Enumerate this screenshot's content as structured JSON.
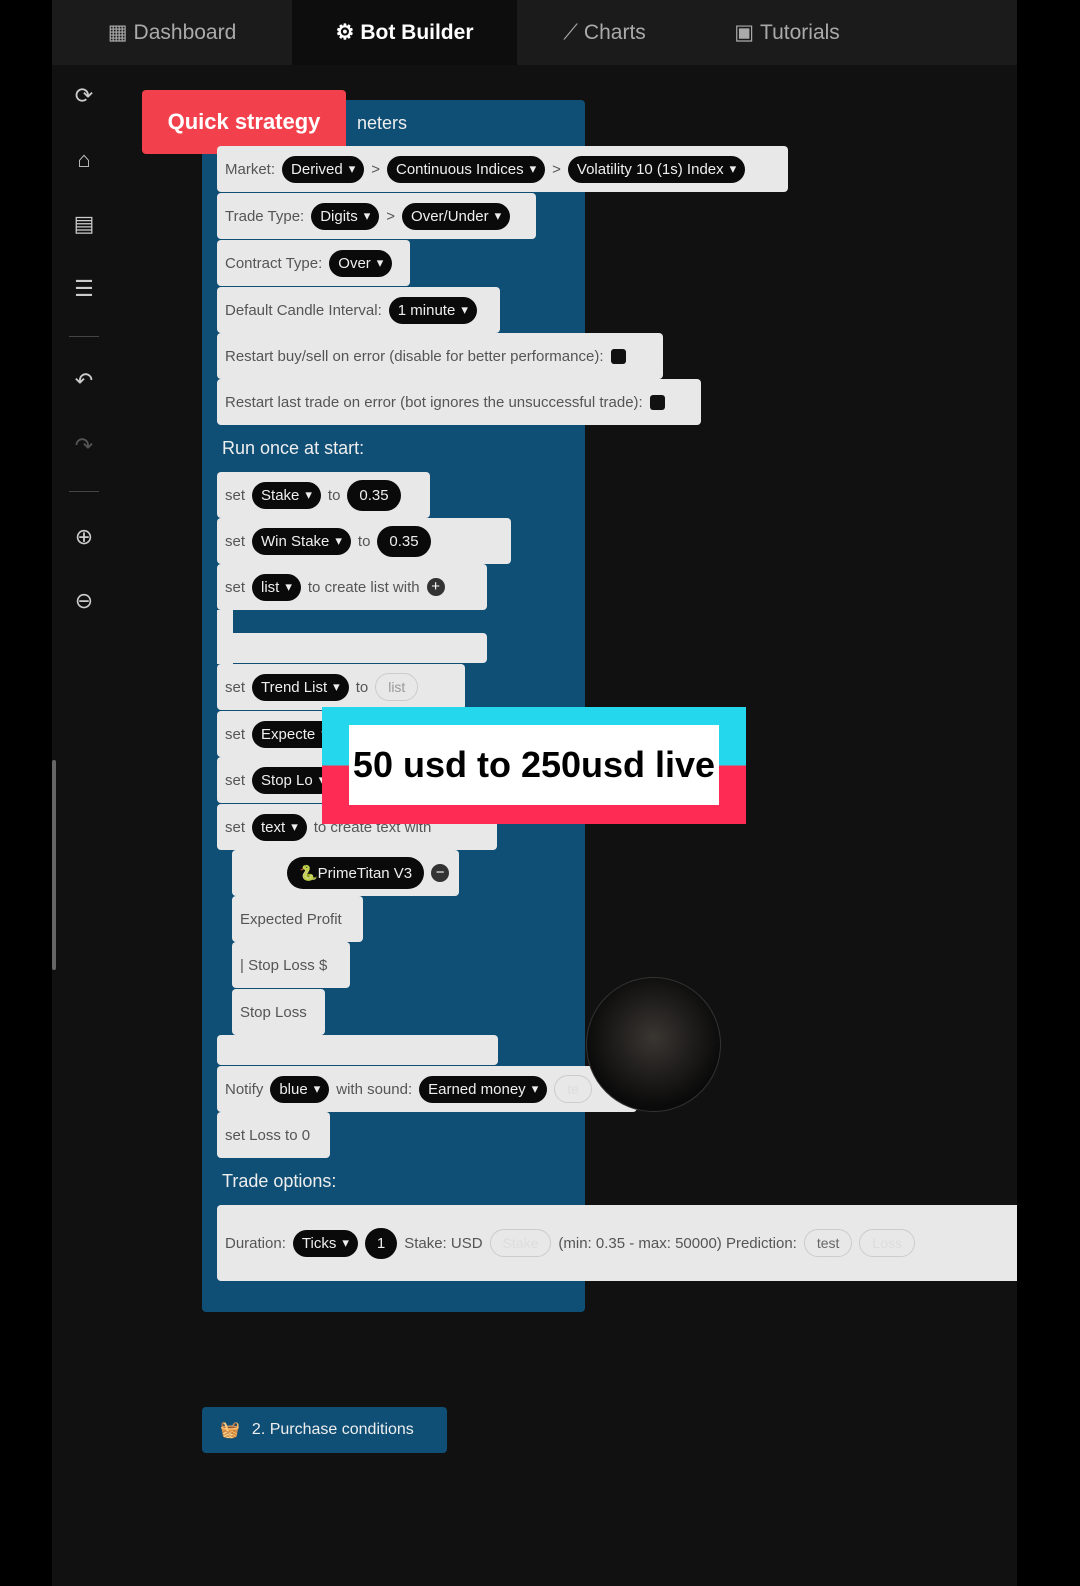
{
  "nav": {
    "tabs": [
      {
        "label": "Dashboard",
        "icon": "dashboard-icon"
      },
      {
        "label": "Bot Builder",
        "icon": "bot-icon",
        "active": true
      },
      {
        "label": "Charts",
        "icon": "chart-icon"
      },
      {
        "label": "Tutorials",
        "icon": "tutorial-icon"
      }
    ]
  },
  "toolbar": [
    "reset-icon",
    "open-icon",
    "save-icon",
    "sort-icon",
    "undo-icon",
    "redo-icon",
    "zoom-in-icon",
    "zoom-out-icon"
  ],
  "quick_strategy": "Quick strategy",
  "params_title": "neters",
  "market": {
    "label": "Market:",
    "values": [
      "Derived",
      "Continuous Indices",
      "Volatility 10 (1s) Index"
    ]
  },
  "trade_type": {
    "label": "Trade Type:",
    "values": [
      "Digits",
      "Over/Under"
    ]
  },
  "contract_type": {
    "label": "Contract Type:",
    "value": "Over"
  },
  "candle": {
    "label": "Default Candle Interval:",
    "value": "1 minute"
  },
  "restart_buy": "Restart buy/sell on error (disable for better performance):",
  "restart_last": "Restart last trade on error (bot ignores the unsuccessful trade):",
  "run_once": "Run once at start:",
  "set": "set",
  "to": "to",
  "stake": {
    "var": "Stake",
    "value": "0.35"
  },
  "win_stake": {
    "var": "Win Stake",
    "value": "0.35"
  },
  "list": {
    "var": "list",
    "text": "to create list with"
  },
  "trend": {
    "var": "Trend List",
    "value": "list"
  },
  "expected": "Expecte",
  "stoplo": "Stop Lo",
  "textv": {
    "var": "text",
    "text": "to create text with"
  },
  "prime": "🐍PrimeTitan V3",
  "exp_profit": "Expected Profit",
  "stop_loss_d": "| Stop Loss $",
  "stop_loss": "Stop Loss",
  "notify": {
    "label": "Notify",
    "color": "blue",
    "with": "with sound:",
    "sound": "Earned money",
    "extra": "te"
  },
  "set_loss": "set Loss to 0",
  "trade_options": "Trade options:",
  "duration": {
    "label": "Duration:",
    "unit": "Ticks",
    "value": "1",
    "stake_label": "Stake:  USD",
    "stake": "Stake",
    "range": "(min: 0.35 - max: 50000) Prediction:",
    "test": "test",
    "loss": "Loss"
  },
  "purchase": "2. Purchase conditions",
  "overlay": "50 usd to 250usd live",
  "colors": {
    "block_blue": "#0f4f75",
    "quick": "#f2414d",
    "tiktok_cyan": "#25d7ec",
    "tiktok_red": "#fe2c55"
  }
}
